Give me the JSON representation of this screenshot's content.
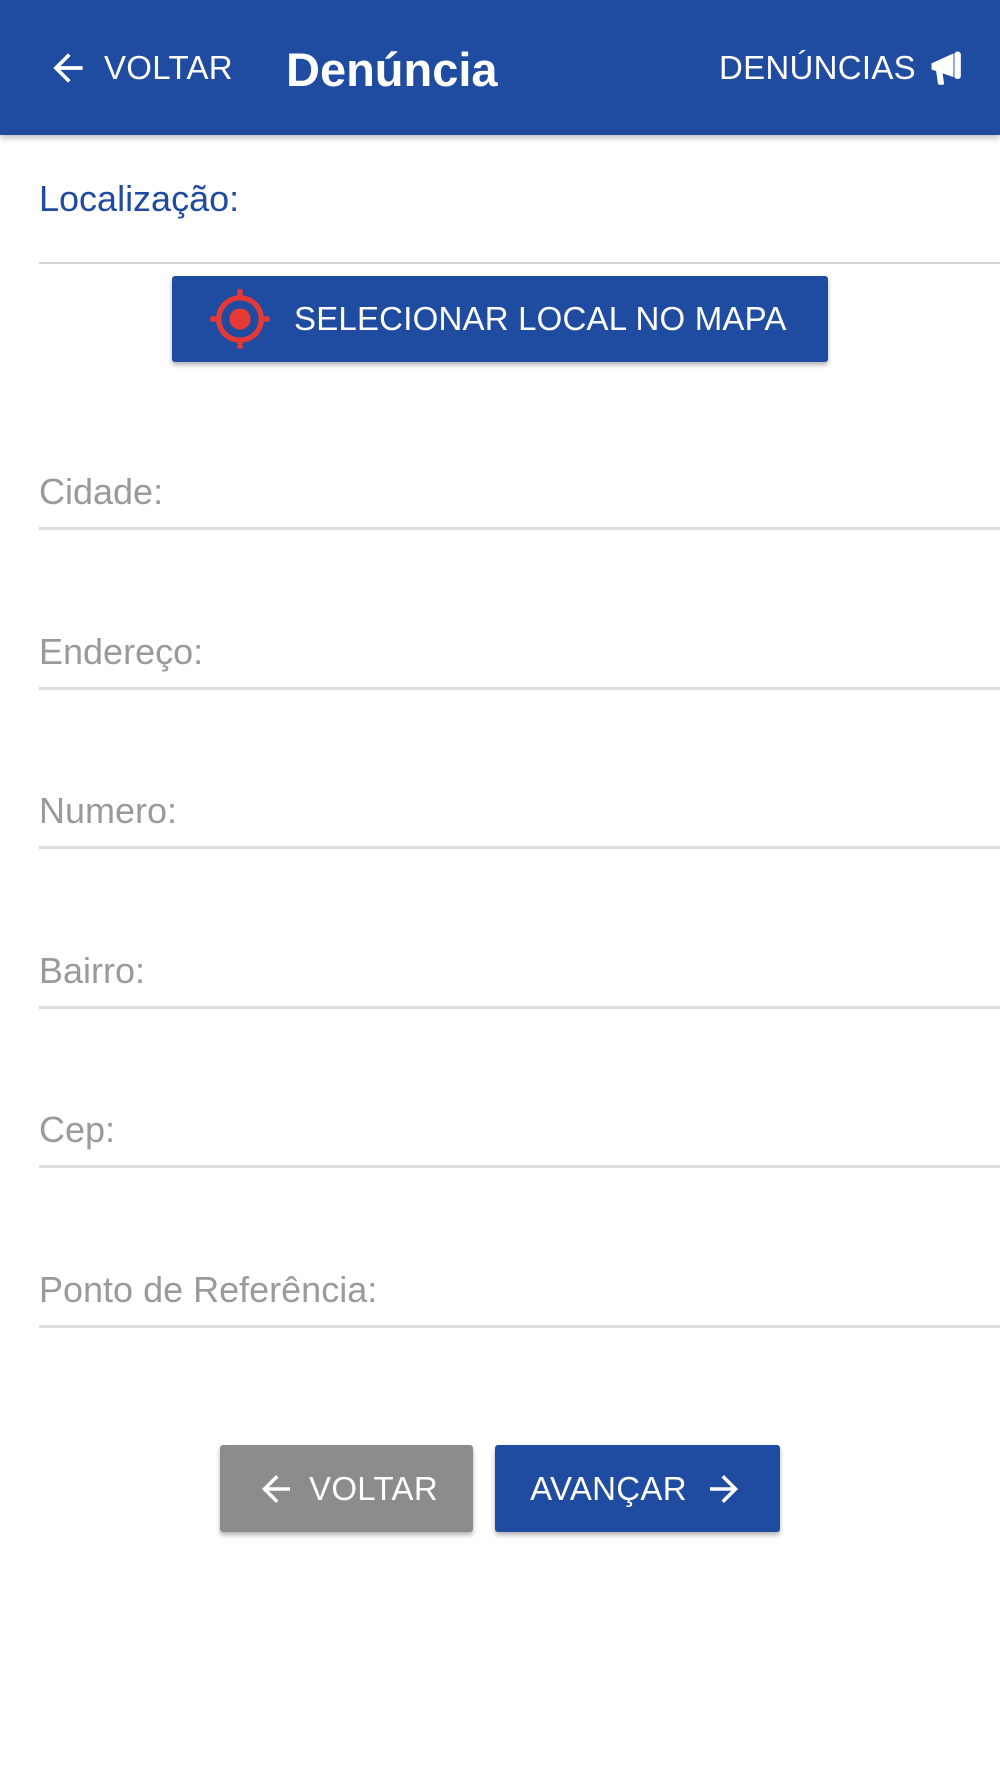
{
  "header": {
    "back_label": "VOLTAR",
    "title": "Denúncia",
    "complaints_label": "DENÚNCIAS"
  },
  "location": {
    "section_label": "Localização:",
    "map_button_label": "SELECIONAR LOCAL NO MAPA"
  },
  "fields": {
    "cidade": {
      "placeholder": "Cidade:",
      "value": ""
    },
    "endereco": {
      "placeholder": "Endereço:",
      "value": ""
    },
    "numero": {
      "placeholder": "Numero:",
      "value": ""
    },
    "bairro": {
      "placeholder": "Bairro:",
      "value": ""
    },
    "cep": {
      "placeholder": "Cep:",
      "value": ""
    },
    "referencia": {
      "placeholder": "Ponto de Referência:",
      "value": ""
    }
  },
  "footer": {
    "back_label": "VOLTAR",
    "next_label": "AVANÇAR"
  },
  "icons": {
    "back": "arrow-left-icon",
    "complaints": "megaphone-icon",
    "map_target": "crosshair-target-icon",
    "next": "arrow-right-icon"
  },
  "colors": {
    "primary": "#1f4ba0",
    "secondary_button": "#8c8c8c",
    "target_icon": "#e53935",
    "placeholder": "#9a9a9a",
    "divider": "#dcdcdc"
  }
}
